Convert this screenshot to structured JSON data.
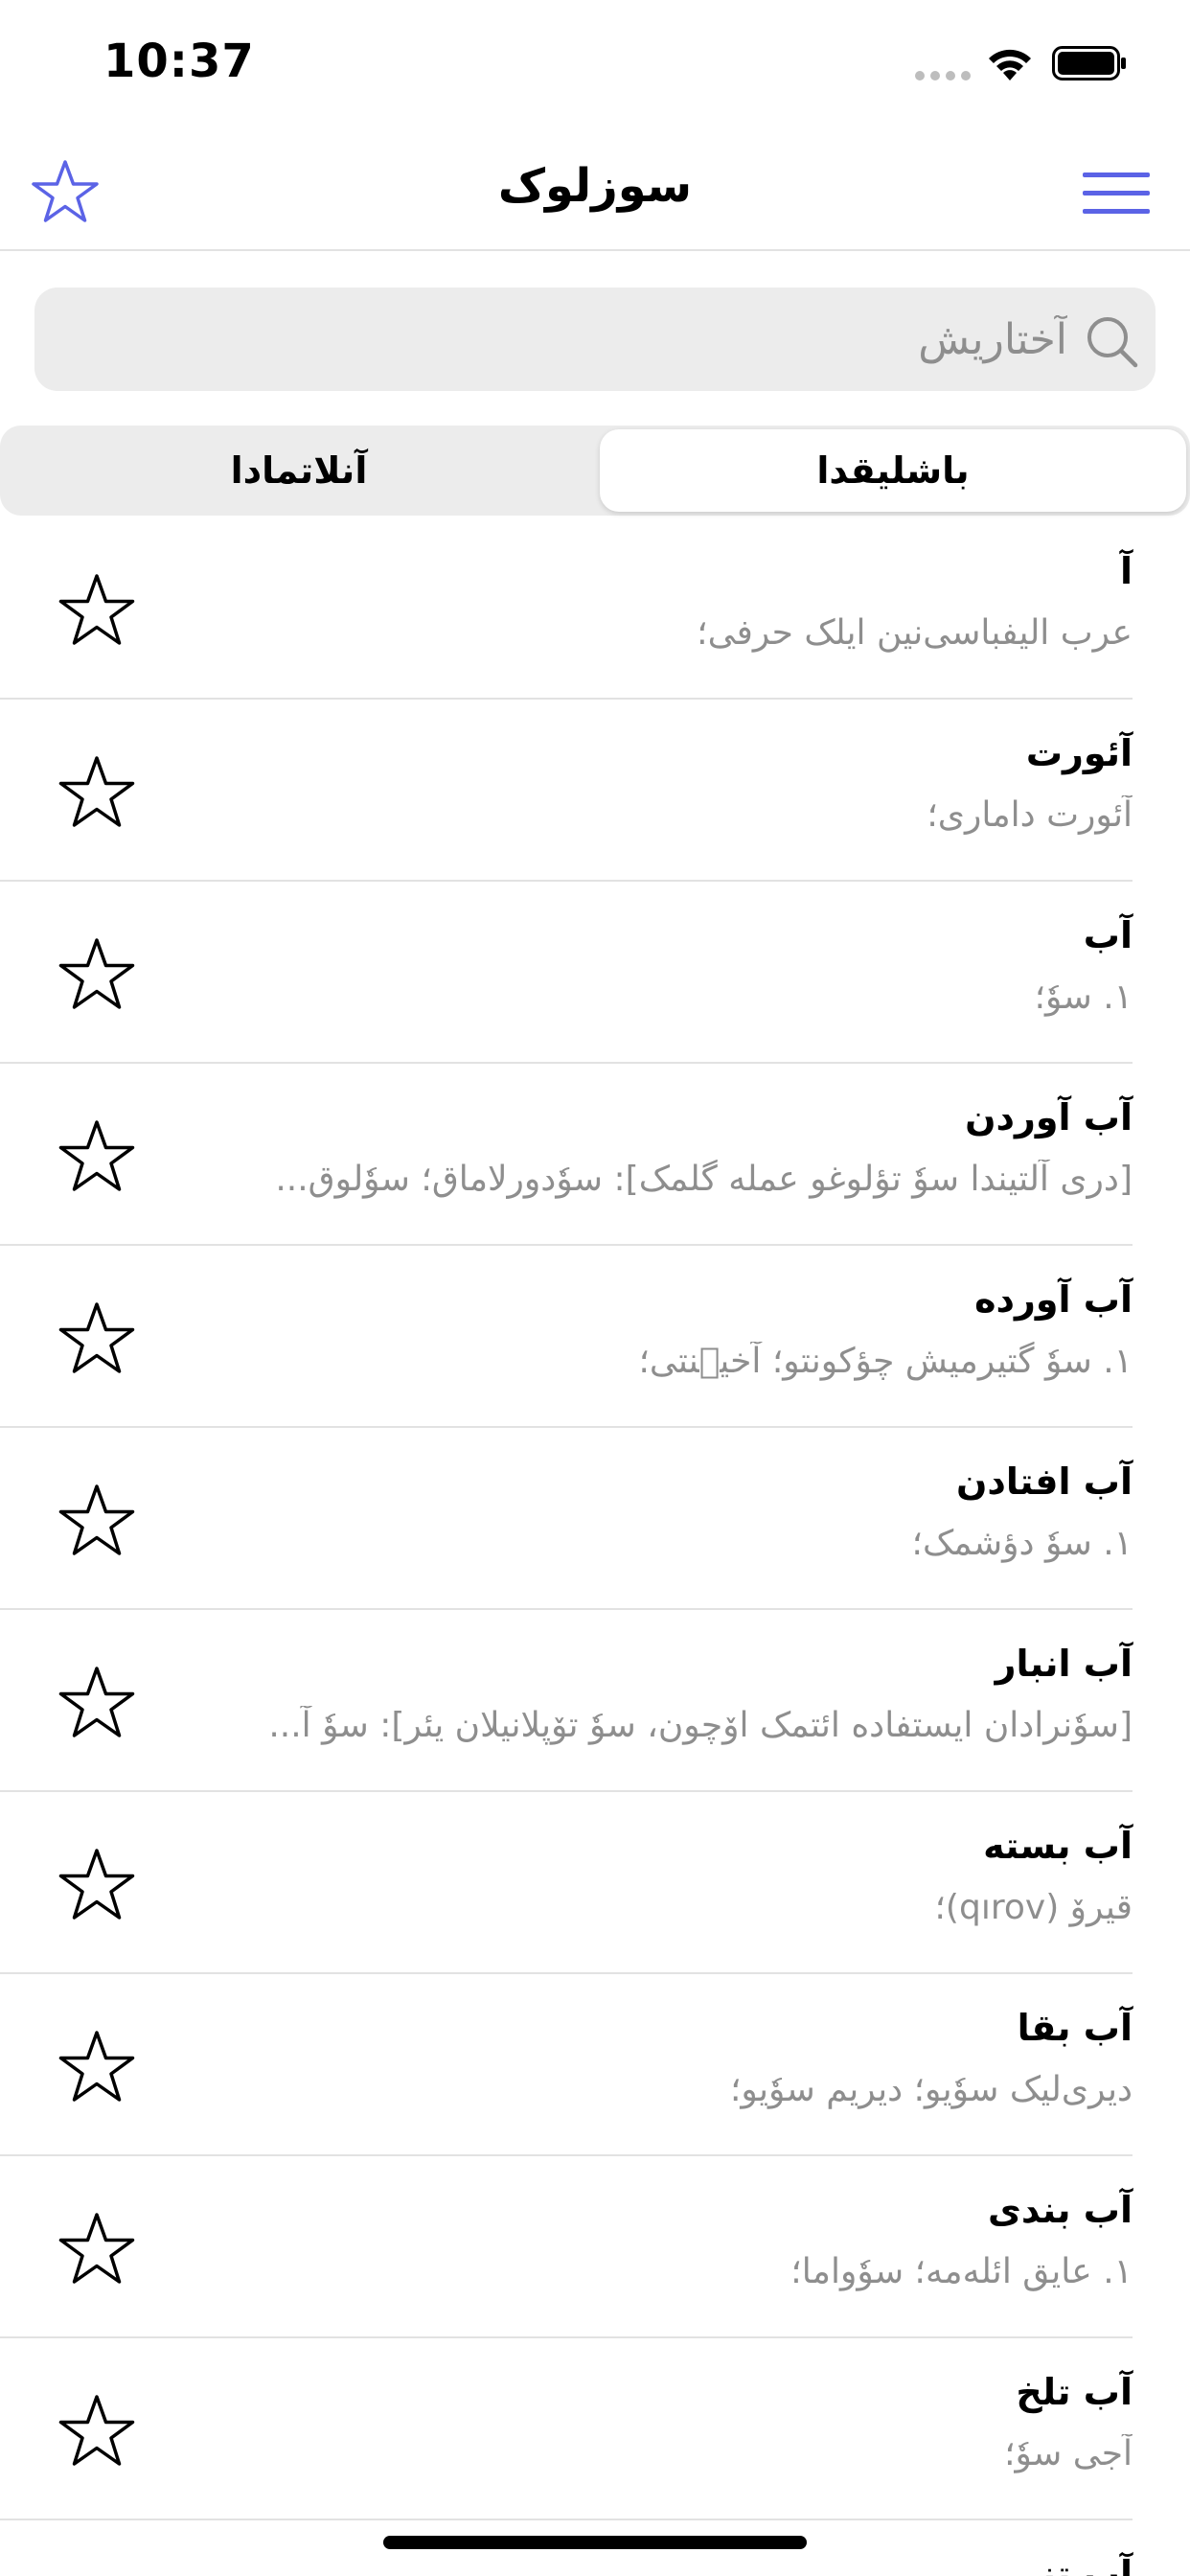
{
  "status_bar": {
    "time": "10:37"
  },
  "header": {
    "title": "سوزلوک",
    "left_icon": "star-outline-icon",
    "right_icon": "hamburger-menu-icon",
    "accent_color": "#5b63e6"
  },
  "search": {
    "placeholder": "آختاریش",
    "value": ""
  },
  "segments": {
    "active_label": "باشلیقدا",
    "inactive_label": "آنلاتمادا"
  },
  "list": {
    "items": [
      {
        "word": "آ",
        "definition": "عرب الیفباسی‌نین ایلک حرفی؛"
      },
      {
        "word": "آئورت",
        "definition": "آئورت داماری؛"
      },
      {
        "word": "آب",
        "definition": "۱. سوٗ؛"
      },
      {
        "word": "آب آوردن",
        "definition": "[دری آلتیندا سوٗ تؤلوغو عمله گلمک]: سوٗدورلاماق؛ سوٗلوق..."
      },
      {
        "word": "آب آورده",
        "definition": "۱. سوٗ گتیرمیش چؤکونتو؛ آخیٛنتی؛"
      },
      {
        "word": "آب افتادن",
        "definition": "۱. سوٗ دؤشمک؛"
      },
      {
        "word": "آب انبار",
        "definition": "[سوٗنرادان ایستفاده ائتمک اوٚچون، سوٗ توٚپلانیلان یئر]: سوٗ آ..."
      },
      {
        "word": "آب بسته",
        "definition": "قیروٚ (qırov)؛"
      },
      {
        "word": "آب بقا",
        "definition": "دیری‌لیک سوٗیو؛ دیریم سوٗیو؛"
      },
      {
        "word": "آب بندی",
        "definition": "۱. عایق ائله‌مه؛ سوٗواما؛"
      },
      {
        "word": "آب تلخ",
        "definition": "آجی سوٗ؛"
      },
      {
        "word": "آب تنی",
        "definition": ""
      }
    ]
  }
}
